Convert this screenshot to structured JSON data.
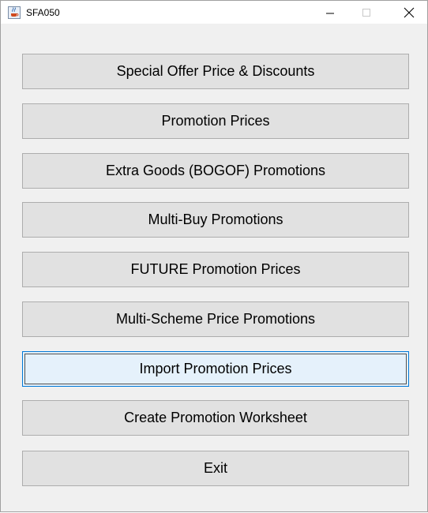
{
  "window": {
    "title": "SFA050",
    "icon": "java-cup-icon",
    "controls": {
      "minimize": "—",
      "maximize": "□",
      "close": "✕"
    }
  },
  "menu": {
    "focused_index": 6,
    "buttons": [
      {
        "label": "Special Offer Price & Discounts"
      },
      {
        "label": "Promotion Prices"
      },
      {
        "label": "Extra Goods (BOGOF) Promotions"
      },
      {
        "label": "Multi-Buy Promotions"
      },
      {
        "label": "FUTURE Promotion Prices"
      },
      {
        "label": "Multi-Scheme Price Promotions"
      },
      {
        "label": "Import Promotion Prices"
      },
      {
        "label": "Create Promotion Worksheet"
      },
      {
        "label": "Exit"
      }
    ]
  },
  "colors": {
    "button_bg": "#e1e1e1",
    "button_border": "#adadad",
    "focused_bg": "#e5f1fb",
    "focused_border": "#0078d7",
    "panel_bg": "#f0f0f0"
  }
}
